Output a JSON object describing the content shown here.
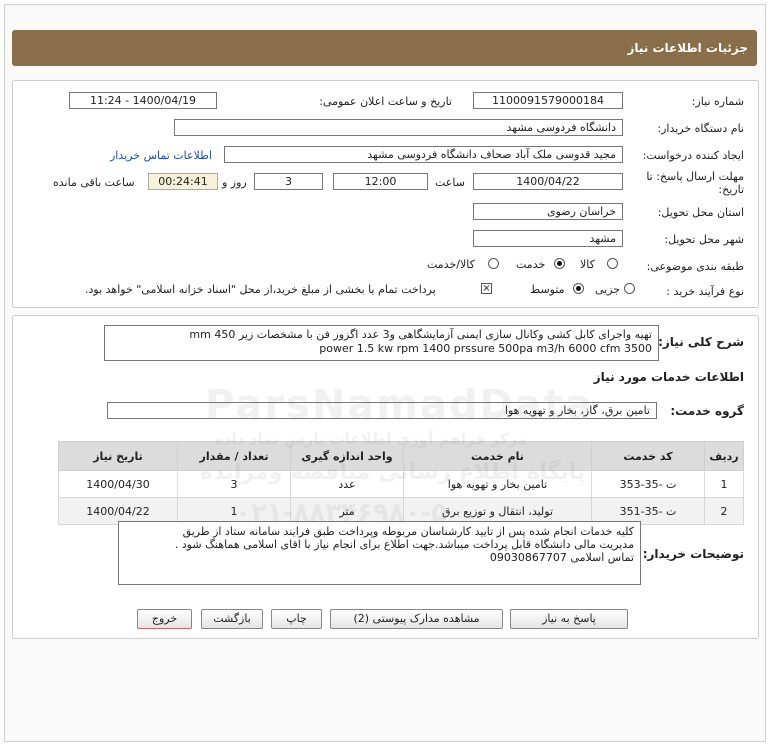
{
  "header": {
    "title": "جزئیات اطلاعات نیاز"
  },
  "form": {
    "need_number_label": "شماره نیاز:",
    "need_number": "1100091579000184",
    "announce_label": "تاریخ و ساعت اعلان عمومی:",
    "announce_value": "1400/04/19 - 11:24",
    "buyer_org_label": "نام دستگاه خریدار:",
    "buyer_org": "دانشگاه فردوسی مشهد",
    "requester_label": "ایجاد کننده درخواست:",
    "requester": "مجید قدوسی ملک آباد صحاف دانشگاه فردوسی مشهد",
    "contact_link": "اطلاعات تماس خریدار",
    "deadline_label_1": "مهلت ارسال پاسخ: تا",
    "deadline_label_2": "تاریخ:",
    "deadline_date": "1400/04/22",
    "time_label": "ساعت",
    "deadline_time": "12:00",
    "days_value": "3",
    "days_label": "روز و",
    "remaining_time": "00:24:41",
    "remaining_label": "ساعت باقی مانده",
    "province_label": "استان محل تحویل:",
    "province": "خراسان رضوی",
    "city_label": "شهر محل تحویل:",
    "city": "مشهد",
    "category_label": "طبقه بندی موضوعی:",
    "category_options": [
      "کالا",
      "خدمت",
      "کالا/خدمت"
    ],
    "category_selected": "خدمت",
    "process_label": "نوع فرآیند خرید :",
    "process_options": [
      "جزیی",
      "متوسط"
    ],
    "process_selected": "متوسط",
    "payment_note": "پرداخت تمام یا بخشی از مبلغ خرید،از محل \"اسناد خزانه اسلامی\" خواهد بود."
  },
  "description": {
    "label": "شرح کلی نیاز:",
    "line1": "تهیه واجرای کابل کشی وکانال سازی ایمنی  آزمایشگاهی و3 عدد اگزوز فن با مشخصات زیر 450 mm",
    "line2": "power 1.5 kw rpm  1400 prssure 500pa m3/h 6000 cfm 3500"
  },
  "services": {
    "section_title": "اطلاعات خدمات مورد نیاز",
    "group_label": "گروه خدمت:",
    "group_value": "تامین برق، گاز، بخار و تهویه هوا",
    "columns": [
      "ردیف",
      "کد خدمت",
      "نام خدمت",
      "واحد اندازه گیری",
      "تعداد / مقدار",
      "تاریخ نیاز"
    ],
    "rows": [
      [
        "1",
        "ت -35-353",
        "تامین بخار و تهویه هوا",
        "عدد",
        "3",
        "1400/04/30"
      ],
      [
        "2",
        "ت -35-351",
        "تولید، انتقال و توزیع برق",
        "متر",
        "1",
        "1400/04/22"
      ]
    ]
  },
  "buyer_notes": {
    "label": "توضیحات خریدار:",
    "line1": "کلیه خدمات انجام شده پس از تایید کارشناسان مربوطه وپرداخت طبق فرایند سامانه ستاد از طریق",
    "line2": "مدیریت مالی دانشگاه قابل پرداخت میباشد.جهت اطلاع برای انجام نیاز با اقای اسلامی هماهنگ شود .",
    "line3": "تماس اسلامی          09030867707"
  },
  "buttons": {
    "reply": "پاسخ به نیاز",
    "attachments": "مشاهده مدارک پیوستی (2)",
    "print": "چاپ",
    "back": "بازگشت",
    "exit": "خروج"
  },
  "watermark": {
    "line1": "ParsNamadData",
    "line2": "مرکز فراهم آوری اطلاعات پارس نماد داده",
    "line3": "پایگاه اطلاع رسانی مناقصه ومزایده",
    "line4": "۰۲۱-۸۸۳۴۶۹۸۰-۵"
  },
  "colors": {
    "title_bar": "#8a6e4b",
    "table_header": "#dcdcdc",
    "link": "#1a4fa0",
    "timer_bg": "#f7f1d9"
  }
}
